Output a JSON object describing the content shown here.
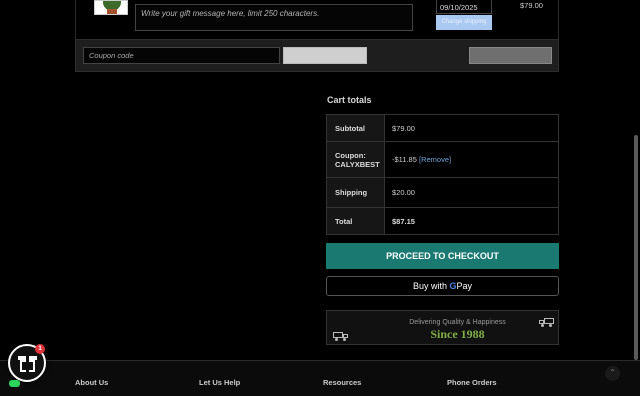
{
  "cart_item": {
    "gift_message_placeholder": "Write your gift message here, limit 250 characters.",
    "delivery_date": "09/10/2025",
    "shipping_button_label": "Change shipping",
    "price": "$79.00"
  },
  "coupon": {
    "input_placeholder": "Coupon code",
    "apply_label": "Apply coupon",
    "update_cart_label": "Update cart"
  },
  "cart_totals": {
    "title": "Cart totals",
    "subtotal_label": "Subtotal",
    "subtotal_value": "$79.00",
    "coupon_label": "Coupon: CALYXBEST",
    "coupon_value": "-$11.85",
    "coupon_remove": "[Remove]",
    "shipping_label": "Shipping",
    "shipping_value": "$20.00",
    "total_label": "Total",
    "total_value": "$87.15"
  },
  "checkout": {
    "proceed_label": "PROCEED TO CHECKOUT",
    "gpay_prefix": "Buy with",
    "gpay_g": "G",
    "gpay_suffix": "Pay"
  },
  "banner": {
    "line1": "Delivering Quality & Happiness",
    "line2": "Since 1988"
  },
  "footer": {
    "about": "About Us",
    "help": "Let Us Help",
    "resources": "Resources",
    "phone": "Phone Orders"
  },
  "widget": {
    "badge_count": "1"
  },
  "colors": {
    "checkout_bg": "#1a7a72",
    "banner_accent": "#7fae44",
    "badge": "#e0343a"
  },
  "icons": [
    "gift-icon",
    "truck-icon",
    "google-g-icon",
    "chevron-up-icon",
    "chat-icon"
  ]
}
